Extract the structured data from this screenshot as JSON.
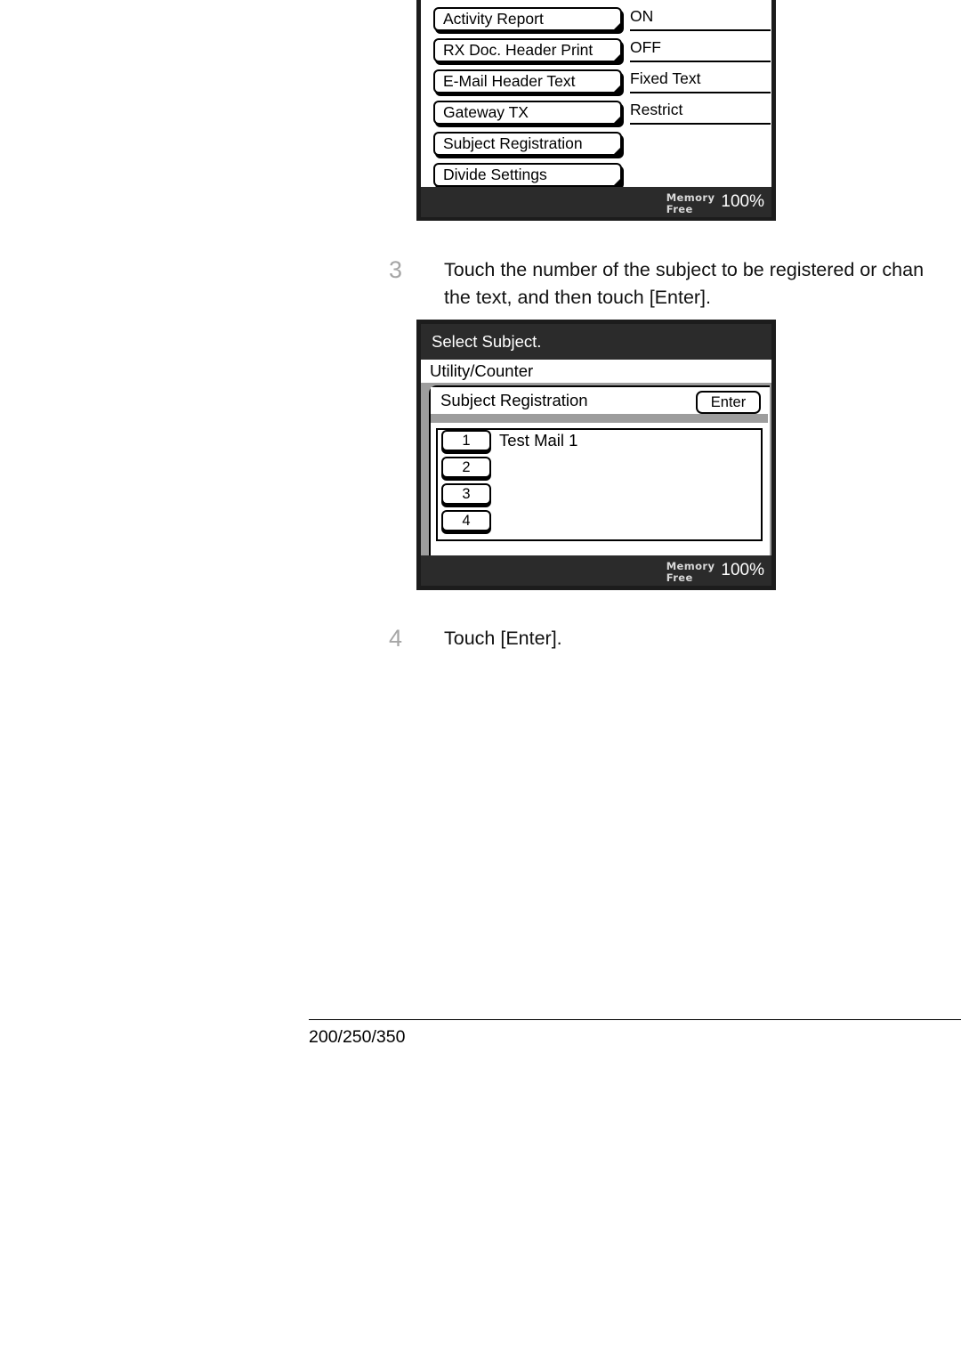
{
  "document": {
    "footer_model": "200/250/350"
  },
  "steps": [
    {
      "number": "3",
      "line1": "Touch the number of the subject to be registered or chan",
      "line2": "the text, and then touch [Enter]."
    },
    {
      "number": "4",
      "line1": "Touch [Enter].",
      "line2": ""
    }
  ],
  "panel_settings": {
    "rows": [
      {
        "key": "Activity Report",
        "value": "ON"
      },
      {
        "key": "RX Doc. Header Print",
        "value": "OFF"
      },
      {
        "key": "E-Mail Header Text",
        "value": "Fixed Text"
      },
      {
        "key": "Gateway TX",
        "value": "Restrict"
      },
      {
        "key": "Subject Registration",
        "value": ""
      },
      {
        "key": "Divide Settings",
        "value": ""
      }
    ],
    "status": {
      "memory_line1": "Memory",
      "memory_line2": "Free",
      "memory_percent": "100%"
    }
  },
  "panel_subject": {
    "title": "Select Subject.",
    "menu": "Utility/Counter",
    "section": "Subject Registration",
    "enter_label": "Enter",
    "entries": [
      {
        "number": "1",
        "label": "Test Mail 1"
      },
      {
        "number": "2",
        "label": ""
      },
      {
        "number": "3",
        "label": ""
      },
      {
        "number": "4",
        "label": ""
      }
    ],
    "status": {
      "memory_line1": "Memory",
      "memory_line2": "Free",
      "memory_percent": "100%"
    }
  },
  "colors": {
    "lcd_bezel": "#1c1c1c",
    "title_bar": "#2b2b2b",
    "panel_gray": "#9d9d9d",
    "step_number": "#a6a6a6"
  }
}
